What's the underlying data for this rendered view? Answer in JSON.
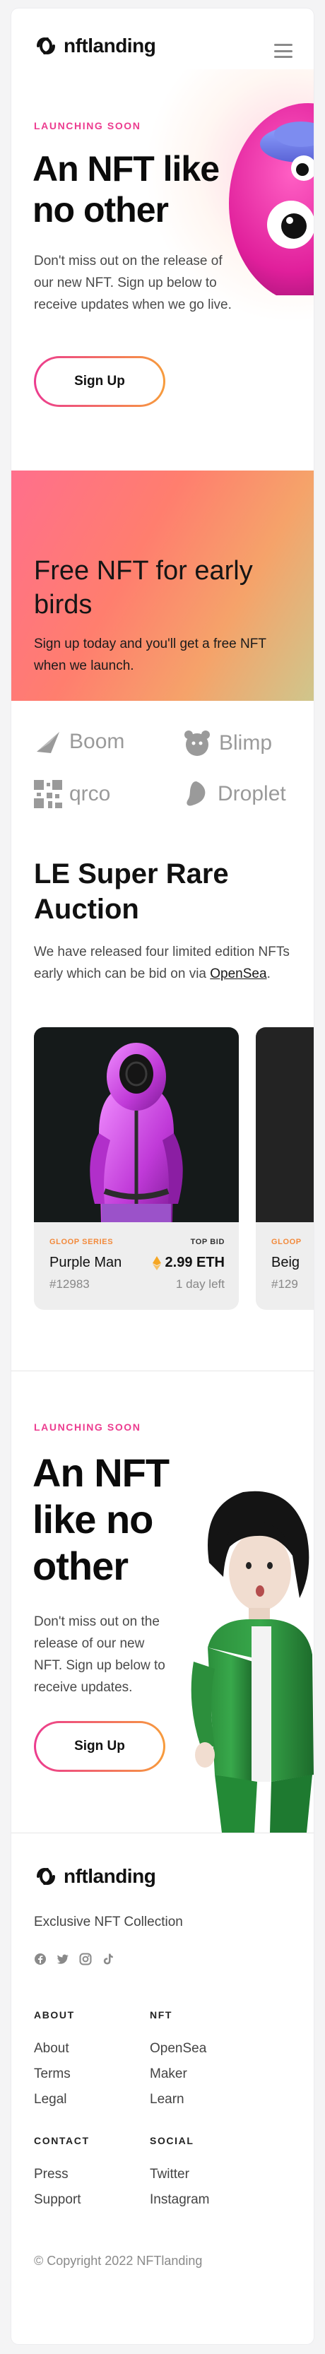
{
  "brand": {
    "name": "nftlanding"
  },
  "hero": {
    "eyebrow": "LAUNCHING SOON",
    "title": "An NFT like no other",
    "text": "Don't miss out on the release of our new NFT. Sign up below to receive updates when we go live.",
    "button": "Sign Up"
  },
  "promo": {
    "title": "Free NFT for early birds",
    "text": "Sign up today and you'll get a free NFT when we launch."
  },
  "brands": [
    "Boom",
    "Blimp",
    "qrco",
    "Droplet"
  ],
  "auction": {
    "title": "LE Super Rare Auction",
    "text": "We have released four limited edition NFTs early which can be bid on via",
    "link": "OpenSea",
    "text_end": ".",
    "cards": [
      {
        "series": "GLOOP SERIES",
        "bid_label": "TOP BID",
        "name": "Purple Man",
        "price": "2.99 ETH",
        "id": "#12983",
        "time": "1 day left"
      },
      {
        "series": "GLOOP",
        "name": "Beig",
        "id": "#129"
      }
    ]
  },
  "hero2": {
    "eyebrow": "LAUNCHING SOON",
    "title": "An NFT like no other",
    "text": "Don't miss out on the release of our new NFT. Sign up below to receive updates.",
    "button": "Sign Up"
  },
  "footer": {
    "tagline": "Exclusive NFT Collection",
    "socials": [
      "facebook-icon",
      "twitter-icon",
      "instagram-icon",
      "tiktok-icon"
    ],
    "columns": [
      {
        "heading": "ABOUT",
        "links": [
          "About",
          "Terms",
          "Legal"
        ]
      },
      {
        "heading": "NFT",
        "links": [
          "OpenSea",
          "Maker",
          "Learn"
        ]
      },
      {
        "heading": "CONTACT",
        "links": [
          "Press",
          "Support"
        ]
      },
      {
        "heading": "SOCIAL",
        "links": [
          "Twitter",
          "Instagram"
        ]
      }
    ],
    "copyright": "© Copyright 2022 NFTlanding"
  },
  "colors": {
    "accent_pink": "#ec3c8f",
    "accent_orange": "#f79c3c",
    "series_orange": "#f28a3c"
  }
}
